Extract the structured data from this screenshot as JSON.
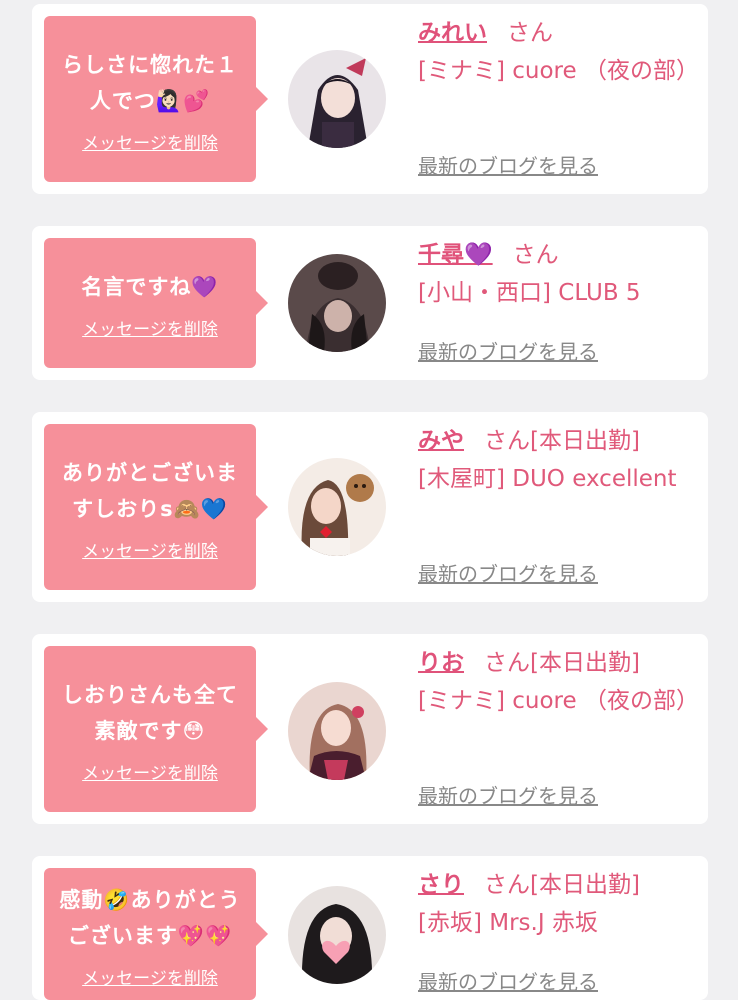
{
  "messages": [
    {
      "message": "らしさに惚れた１\n人でつ🙋🏻‍♀️💕",
      "delete_label": "メッセージを削除",
      "name": "みれい",
      "san": "さん",
      "shop": "[ミナミ] cuore （夜の部）",
      "blog_label": "最新のブログを見る"
    },
    {
      "message": "名言ですね💜",
      "delete_label": "メッセージを削除",
      "name": "千尋💜",
      "san": "さん",
      "shop": "[小山・西口] CLUB 5",
      "blog_label": "最新のブログを見る"
    },
    {
      "message": "ありがとございま\nすしおりs🙈💙",
      "delete_label": "メッセージを削除",
      "name": "みや",
      "san": "さん[本日出勤]",
      "shop": "[木屋町] DUO excellent",
      "blog_label": "最新のブログを見る"
    },
    {
      "message": "しおりさんも全て\n素敵です😳",
      "delete_label": "メッセージを削除",
      "name": "りお",
      "san": "さん[本日出勤]",
      "shop": "[ミナミ] cuore （夜の部）",
      "blog_label": "最新のブログを見る"
    },
    {
      "message": "感動🤣ありがとう\nございます💖💖",
      "delete_label": "メッセージを削除",
      "name": "さり",
      "san": "さん[本日出勤]",
      "shop": "[赤坂] Mrs.J 赤坂",
      "blog_label": "最新のブログを見る"
    }
  ],
  "colors": {
    "bubble": "#f6909a",
    "name": "#e0527a",
    "link_gray": "#888888",
    "background": "#f0f0f2"
  }
}
